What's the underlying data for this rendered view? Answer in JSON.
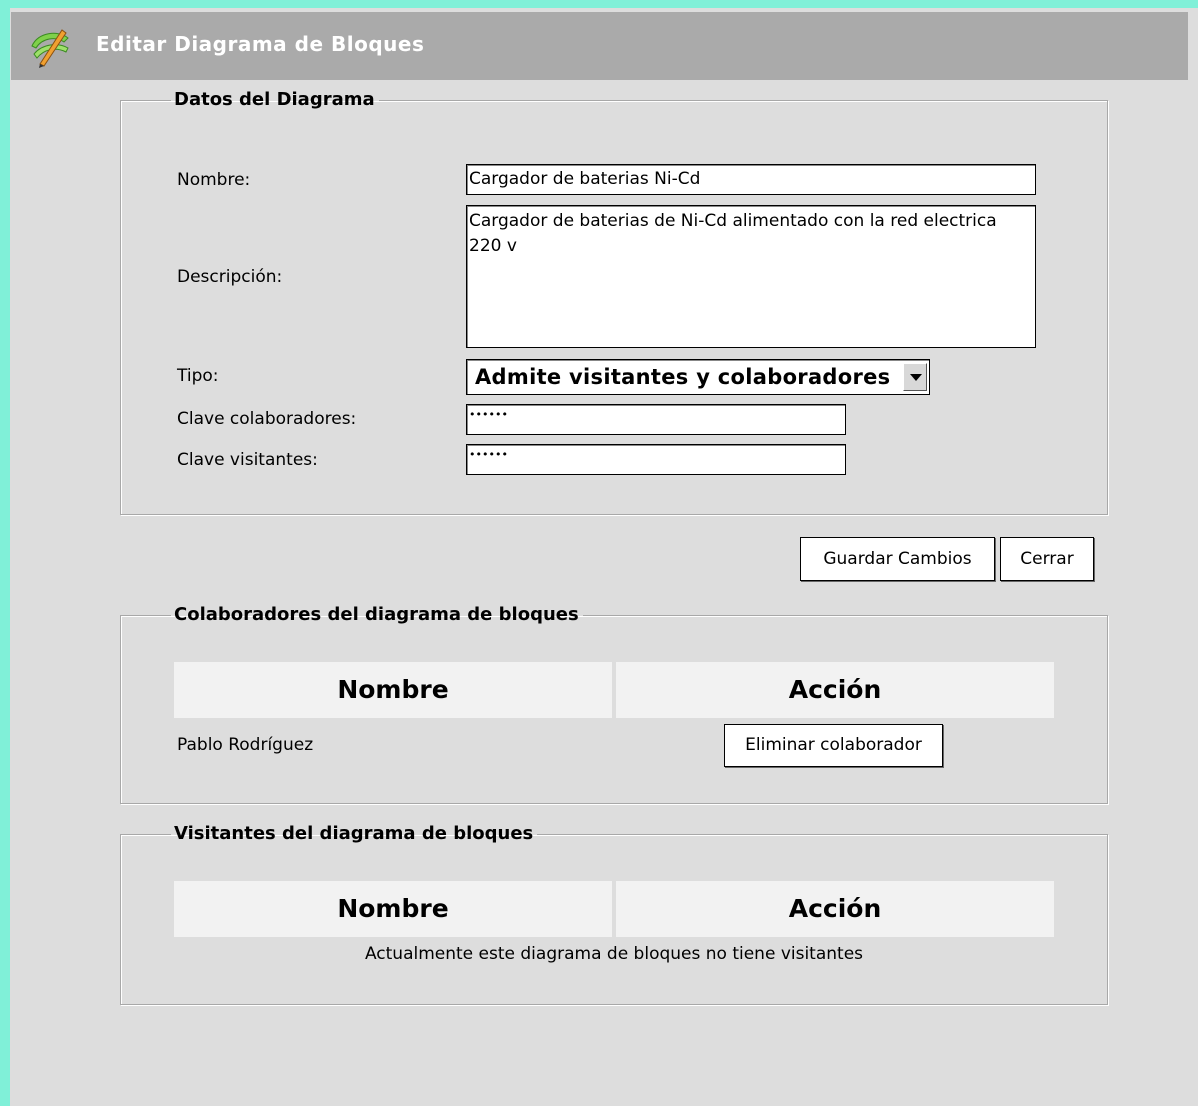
{
  "window": {
    "title": "Editar Diagrama de Bloques",
    "icon": "pencil-ruler-icon"
  },
  "datos": {
    "legend": "Datos del Diagrama",
    "nombre_label": "Nombre:",
    "nombre_value": "Cargador de baterias Ni-Cd",
    "descripcion_label": "Descripción:",
    "descripcion_value": "Cargador de baterias de Ni-Cd alimentado con la red electrica 220 v",
    "tipo_label": "Tipo:",
    "tipo_value": "Admite visitantes y colaboradores",
    "clave_colab_label": "Clave colaboradores:",
    "clave_colab_value": "••••••",
    "clave_visit_label": "Clave visitantes:",
    "clave_visit_value": "••••••"
  },
  "actions": {
    "save_label": "Guardar Cambios",
    "close_label": "Cerrar"
  },
  "colaboradores": {
    "legend": "Colaboradores del diagrama de bloques",
    "headers": [
      "Nombre",
      "Acción"
    ],
    "rows": [
      {
        "nombre": "Pablo Rodríguez",
        "action_label": "Eliminar colaborador"
      }
    ]
  },
  "visitantes": {
    "legend": "Visitantes del diagrama de bloques",
    "headers": [
      "Nombre",
      "Acción"
    ],
    "empty_message": "Actualmente este diagrama de bloques no tiene visitantes"
  },
  "colors": {
    "outer_border": "#80f0d8",
    "panel_bg": "#dddddd",
    "titlebar_bg": "#aaaaaa",
    "header_cell_bg": "#f2f2f2"
  }
}
